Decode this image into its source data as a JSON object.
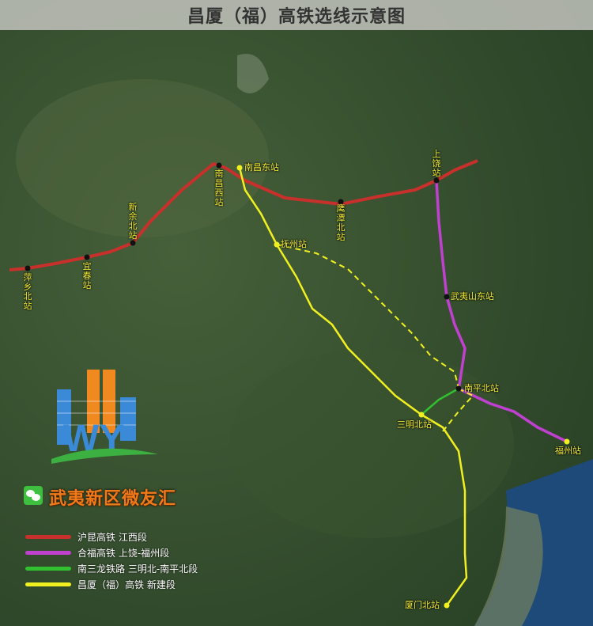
{
  "title": "昌厦（福）高铁选线示意图",
  "stations": {
    "pingxiang_north": "萍乡北站",
    "yichun": "宜春站",
    "xinyu_north": "新余北站",
    "nanchang_west": "南昌西站",
    "nanchang_east": "南昌东站",
    "yingtan_north": "鹰潭北站",
    "shangrao": "上饶站",
    "fuzhou_jx": "抚州站",
    "wuyishan_east": "武夷山东站",
    "nanping_north": "南平北站",
    "sanming_north": "三明北站",
    "fuzhou": "福州站",
    "xiamen_north": "厦门北站"
  },
  "brand": {
    "name": "武夷新区微友汇",
    "logo_text": "WY"
  },
  "legend": [
    {
      "label": "沪昆高铁 江西段",
      "color": "#c8302c"
    },
    {
      "label": "合福高铁 上饶-福州段",
      "color": "#c040d0"
    },
    {
      "label": "南三龙铁路 三明北-南平北段",
      "color": "#30c030"
    },
    {
      "label": "昌厦（福）高铁 新建段",
      "color": "#f0f020"
    }
  ]
}
